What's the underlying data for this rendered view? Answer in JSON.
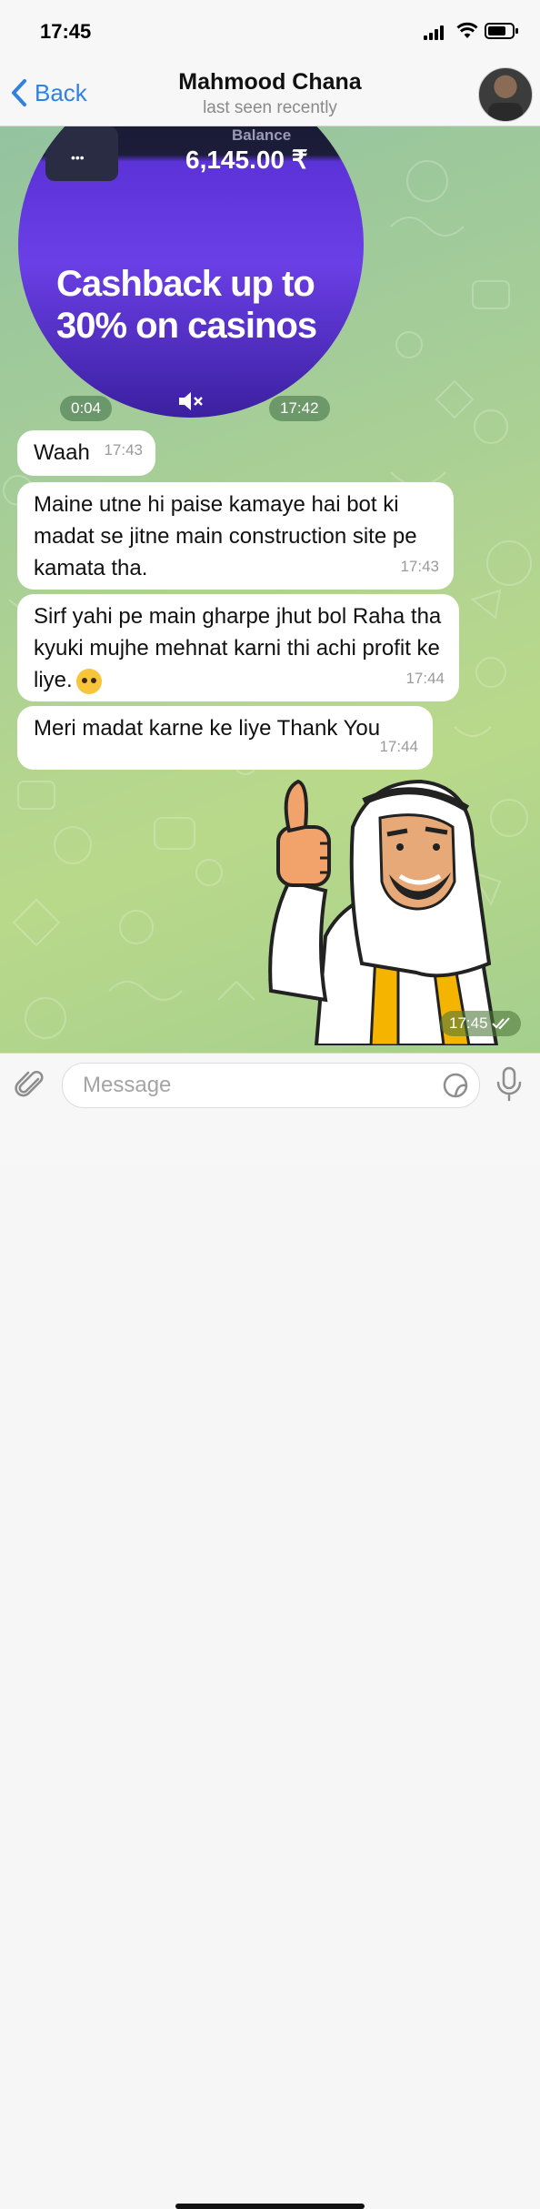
{
  "status_bar": {
    "time": "17:45"
  },
  "header": {
    "back_label": "Back",
    "contact_name": "Mahmood Chana",
    "status": "last seen recently"
  },
  "video_message": {
    "balance_label": "Balance",
    "balance_value": "6,145.00 ₹",
    "promo_text": "Cashback up to 30% on casinos",
    "duration": "0:04",
    "time": "17:42"
  },
  "messages": [
    {
      "text": "Waah",
      "time": "17:43"
    },
    {
      "text": "Maine utne hi paise kamaye hai bot ki madat se jitne main construction site pe kamata tha.",
      "time": "17:43"
    },
    {
      "text": "Sirf yahi pe main gharpe jhut bol Raha tha kyuki mujhe mehnat karni thi achi profit ke liye.",
      "time": "17:44",
      "emoji": "pleading-face"
    },
    {
      "text": "Meri madat karne ke liye Thank You",
      "time": "17:44"
    }
  ],
  "sticker_message": {
    "time": "17:45",
    "status_icon": "double-check-icon"
  },
  "input": {
    "placeholder": "Message"
  },
  "colors": {
    "accent": "#2f82e0",
    "chat_bg": "#a9cf96",
    "bubble": "#ffffff"
  }
}
